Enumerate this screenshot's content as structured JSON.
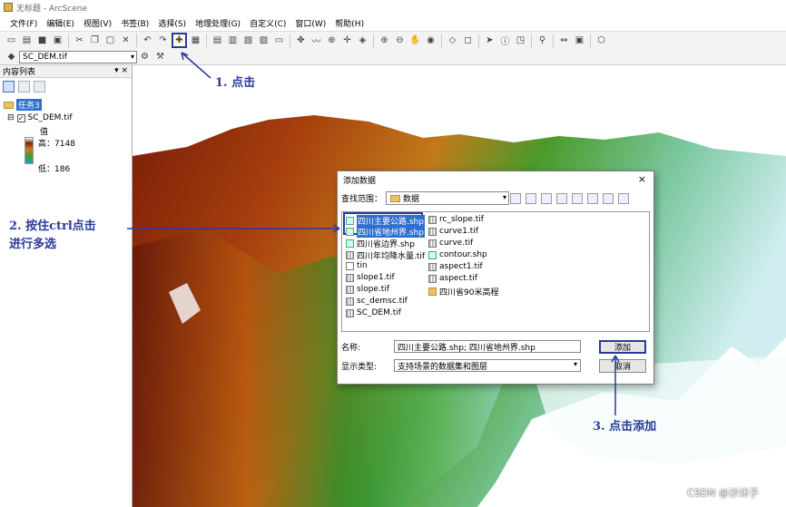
{
  "window": {
    "title": "无标题 - ArcScene"
  },
  "menu": [
    "文件(F)",
    "编辑(E)",
    "视图(V)",
    "书签(B)",
    "选择(S)",
    "地理处理(G)",
    "自定义(C)",
    "窗口(W)",
    "帮助(H)"
  ],
  "layer_selector": {
    "value": "SC_DEM.tif"
  },
  "toc": {
    "title": "内容列表",
    "controls": "▾ ×",
    "group": "任务3",
    "layer": "SC_DEM.tif",
    "value_label": "值",
    "high": "高：7148",
    "low": "低：186"
  },
  "dialog": {
    "title": "添加数据",
    "close": "×",
    "look_in_label": "查找范围：",
    "look_in_value": "数据",
    "files_col1": [
      {
        "name": "四川主要公路.shp",
        "type": "shp",
        "selected": true
      },
      {
        "name": "四川省地州界.shp",
        "type": "shp",
        "selected": true
      },
      {
        "name": "四川省边界.shp",
        "type": "shp",
        "selected": false
      },
      {
        "name": "四川年均降水量.tif",
        "type": "raster",
        "selected": false
      },
      {
        "name": "tin",
        "type": "tin",
        "selected": false
      },
      {
        "name": "slope1.tif",
        "type": "raster",
        "selected": false
      },
      {
        "name": "slope.tif",
        "type": "raster",
        "selected": false
      },
      {
        "name": "sc_demsc.tif",
        "type": "raster",
        "selected": false
      },
      {
        "name": "SC_DEM.tif",
        "type": "raster",
        "selected": false
      }
    ],
    "files_col2": [
      {
        "name": "rc_slope.tif",
        "type": "raster"
      },
      {
        "name": "curve1.tif",
        "type": "raster"
      },
      {
        "name": "curve.tif",
        "type": "raster"
      },
      {
        "name": "contour.shp",
        "type": "shp"
      },
      {
        "name": "aspect1.tif",
        "type": "raster"
      },
      {
        "name": "aspect.tif",
        "type": "raster"
      },
      {
        "name": "四川省90米高程",
        "type": "folder"
      }
    ],
    "name_label": "名称:",
    "name_value": "四川主要公路.shp; 四川省地州界.shp",
    "type_label": "显示类型:",
    "type_value": "支持场景的数据集和图层",
    "add_button": "添加",
    "cancel_button": "取消"
  },
  "annotations": {
    "step1": "1. 点击",
    "step2_line1": "2. 按住ctrl点击",
    "step2_line2": "进行多选",
    "step3": "3. 点击添加"
  },
  "watermark": "CSDN @沙沭子",
  "colors": {
    "annotation": "#2a3a9a",
    "selection": "#2e6fd0"
  }
}
